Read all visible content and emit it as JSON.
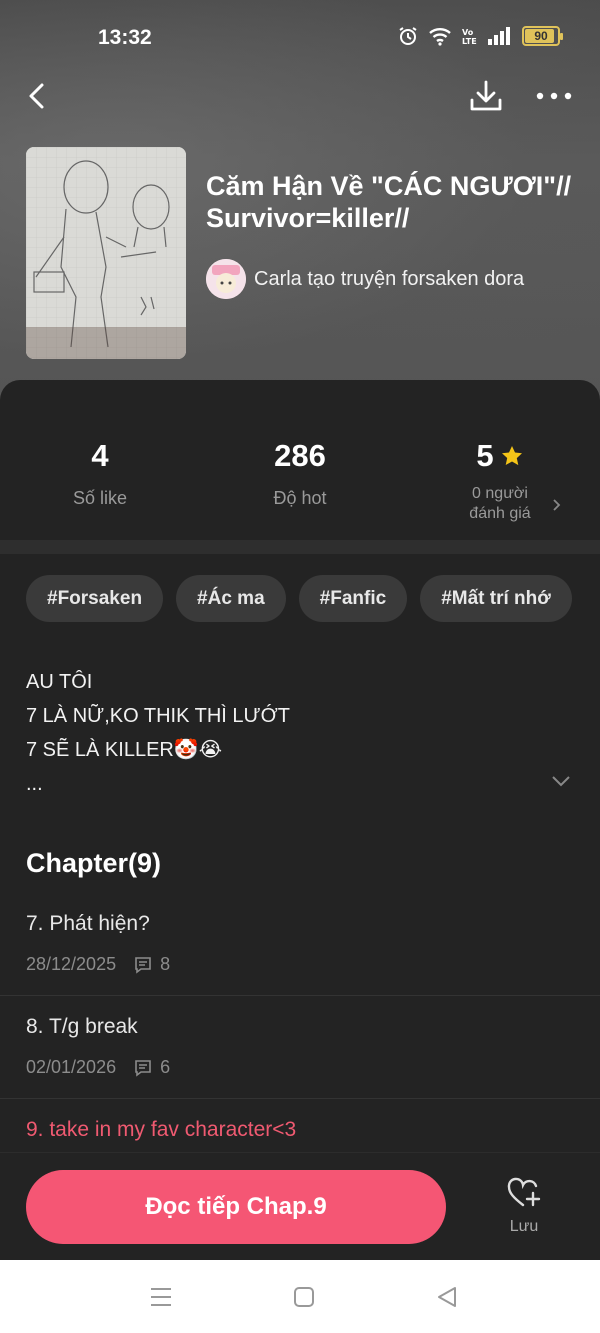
{
  "status_bar": {
    "time": "13:32",
    "battery": "90"
  },
  "story": {
    "title": "Căm Hận Về \"CÁC NGƯƠI\"// Survivor=killer//",
    "author": "Carla tạo truyện forsaken dora"
  },
  "stats": {
    "likes": {
      "value": "4",
      "label": "Số like"
    },
    "hot": {
      "value": "286",
      "label": "Độ hot"
    },
    "rating": {
      "value": "5",
      "label_line1": "0 người",
      "label_line2": "đánh giá"
    }
  },
  "tags": [
    "#Forsaken",
    "#Ác ma",
    "#Fanfic",
    "#Mất trí nhớ"
  ],
  "description": {
    "line1": "AU TÔI",
    "line2": "7 LÀ NỮ,KO THIK THÌ LƯỚT",
    "line3": "7 SẼ LÀ KILLER🤡😭",
    "line4": "..."
  },
  "chapters": {
    "heading": "Chapter(9)",
    "items": [
      {
        "title": "7. Phát hiện?",
        "date": "28/12/2025",
        "comments": "8"
      },
      {
        "title": "8. T/g break",
        "date": "02/01/2026",
        "comments": "6"
      },
      {
        "title": "9. take in my fav character<3"
      }
    ]
  },
  "actions": {
    "read_label": "Đọc tiếp Chap.9",
    "save_label": "Lưu"
  },
  "colors": {
    "accent": "#f55674",
    "star": "#f5c518"
  },
  "icons": [
    "back-icon",
    "download-icon",
    "more-icon",
    "star-icon",
    "chevron-right-icon",
    "chevron-down-icon",
    "comment-icon",
    "heart-plus-icon",
    "menu-icon",
    "home-icon",
    "back-triangle-icon"
  ]
}
